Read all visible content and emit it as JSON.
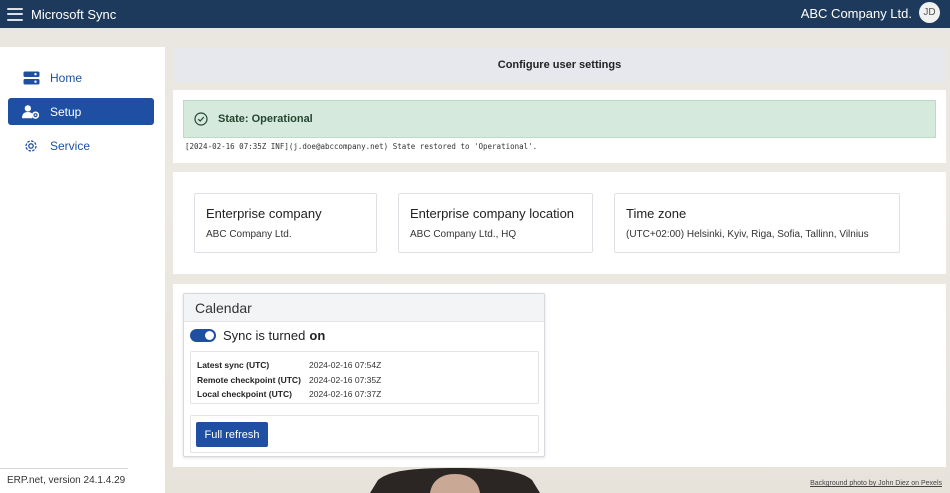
{
  "topbar": {
    "app_title": "Microsoft Sync",
    "company": "ABC Company Ltd.",
    "avatar_initials": "JD",
    "color": "#1d3a5c"
  },
  "sidebar": {
    "items": [
      {
        "label": "Home",
        "icon": "home-icon",
        "active": false
      },
      {
        "label": "Setup",
        "icon": "user-gear-icon",
        "active": true
      },
      {
        "label": "Service",
        "icon": "gear-icon",
        "active": false
      }
    ],
    "version": "ERP.net, version 24.1.4.29"
  },
  "main": {
    "header": "Configure user settings",
    "state": {
      "title": "State: Operational",
      "log": "[2024-02-16 07:35Z INF](j.doe@abccompany.net) State restored to 'Operational'."
    },
    "info": [
      {
        "title": "Enterprise company",
        "value": "ABC Company Ltd."
      },
      {
        "title": "Enterprise company location",
        "value": "ABC Company Ltd., HQ"
      },
      {
        "title": "Time zone",
        "value": "(UTC+02:00) Helsinki, Kyiv, Riga, Sofia, Tallinn, Vilnius"
      }
    ],
    "calendar": {
      "title": "Calendar",
      "sync_prefix": "Sync is turned",
      "sync_state": "on",
      "stats": [
        {
          "label": "Latest sync (UTC)",
          "value": "2024-02-16 07:54Z"
        },
        {
          "label": "Remote checkpoint (UTC)",
          "value": "2024-02-16 07:35Z"
        },
        {
          "label": "Local checkpoint (UTC)",
          "value": "2024-02-16 07:37Z"
        }
      ],
      "refresh_label": "Full refresh"
    }
  },
  "footer": {
    "photo_credit": "Background photo by John Diez on Pexels"
  },
  "colors": {
    "accent": "#1f4fa3",
    "success_bg": "#d6e9dd"
  }
}
